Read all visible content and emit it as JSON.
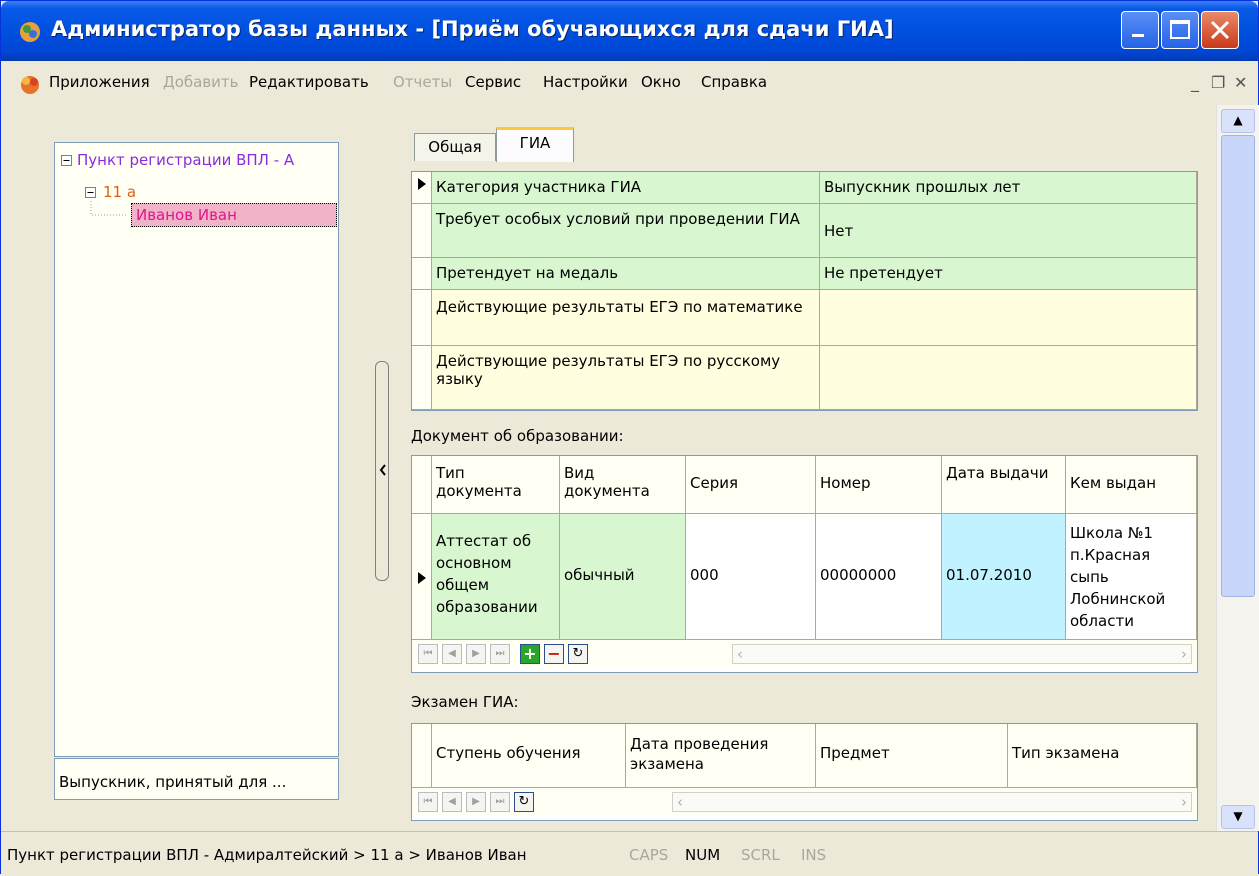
{
  "window": {
    "title": "Администратор базы данных - [Приём обучающихся для сдачи ГИА]"
  },
  "menu": {
    "items": [
      {
        "label": "Приложения",
        "enabled": true
      },
      {
        "label": "Добавить",
        "enabled": false
      },
      {
        "label": "Редактировать",
        "enabled": true
      },
      {
        "label": "Отчеты",
        "enabled": false
      },
      {
        "label": "Сервис",
        "enabled": true
      },
      {
        "label": "Настройки",
        "enabled": true
      },
      {
        "label": "Окно",
        "enabled": true
      },
      {
        "label": "Справка",
        "enabled": true
      }
    ]
  },
  "tree": {
    "root": "Пункт регистрации ВПЛ - А",
    "group": "11 а",
    "leaf": "Иванов Иван",
    "footer": "Выпускник, принятый для ..."
  },
  "tabs": {
    "general": "Общая",
    "gia": "ГИА"
  },
  "properties": [
    {
      "label": "Категория участника ГИА",
      "value": "Выпускник прошлых лет"
    },
    {
      "label": "Требует особых условий при проведении ГИА",
      "value": "Нет"
    },
    {
      "label": "Претендует на медаль",
      "value": "Не претендует"
    },
    {
      "label": "Действующие результаты ЕГЭ по математике",
      "value": ""
    },
    {
      "label": "Действующие результаты ЕГЭ по русскому языку",
      "value": ""
    }
  ],
  "document": {
    "section_label": "Документ об образовании:",
    "columns": [
      "Тип документа",
      "Вид документа",
      "Серия",
      "Номер",
      "Дата выдачи",
      "Кем выдан"
    ],
    "row": [
      "Аттестат об основном общем образовании",
      "обычный",
      "000",
      "00000000",
      "01.07.2010",
      "Школа №1 п.Красная сыпь Лобнинской области"
    ]
  },
  "exam": {
    "section_label": "Экзамен ГИА:",
    "columns": [
      "Ступень обучения",
      "Дата проведения экзамена",
      "Предмет",
      "Тип экзамена"
    ]
  },
  "statusbar": {
    "path": "Пункт регистрации ВПЛ - Адмиралтейский > 11 а > Иванов Иван",
    "caps": "CAPS",
    "num": "NUM",
    "scrl": "SCRL",
    "ins": "INS"
  }
}
